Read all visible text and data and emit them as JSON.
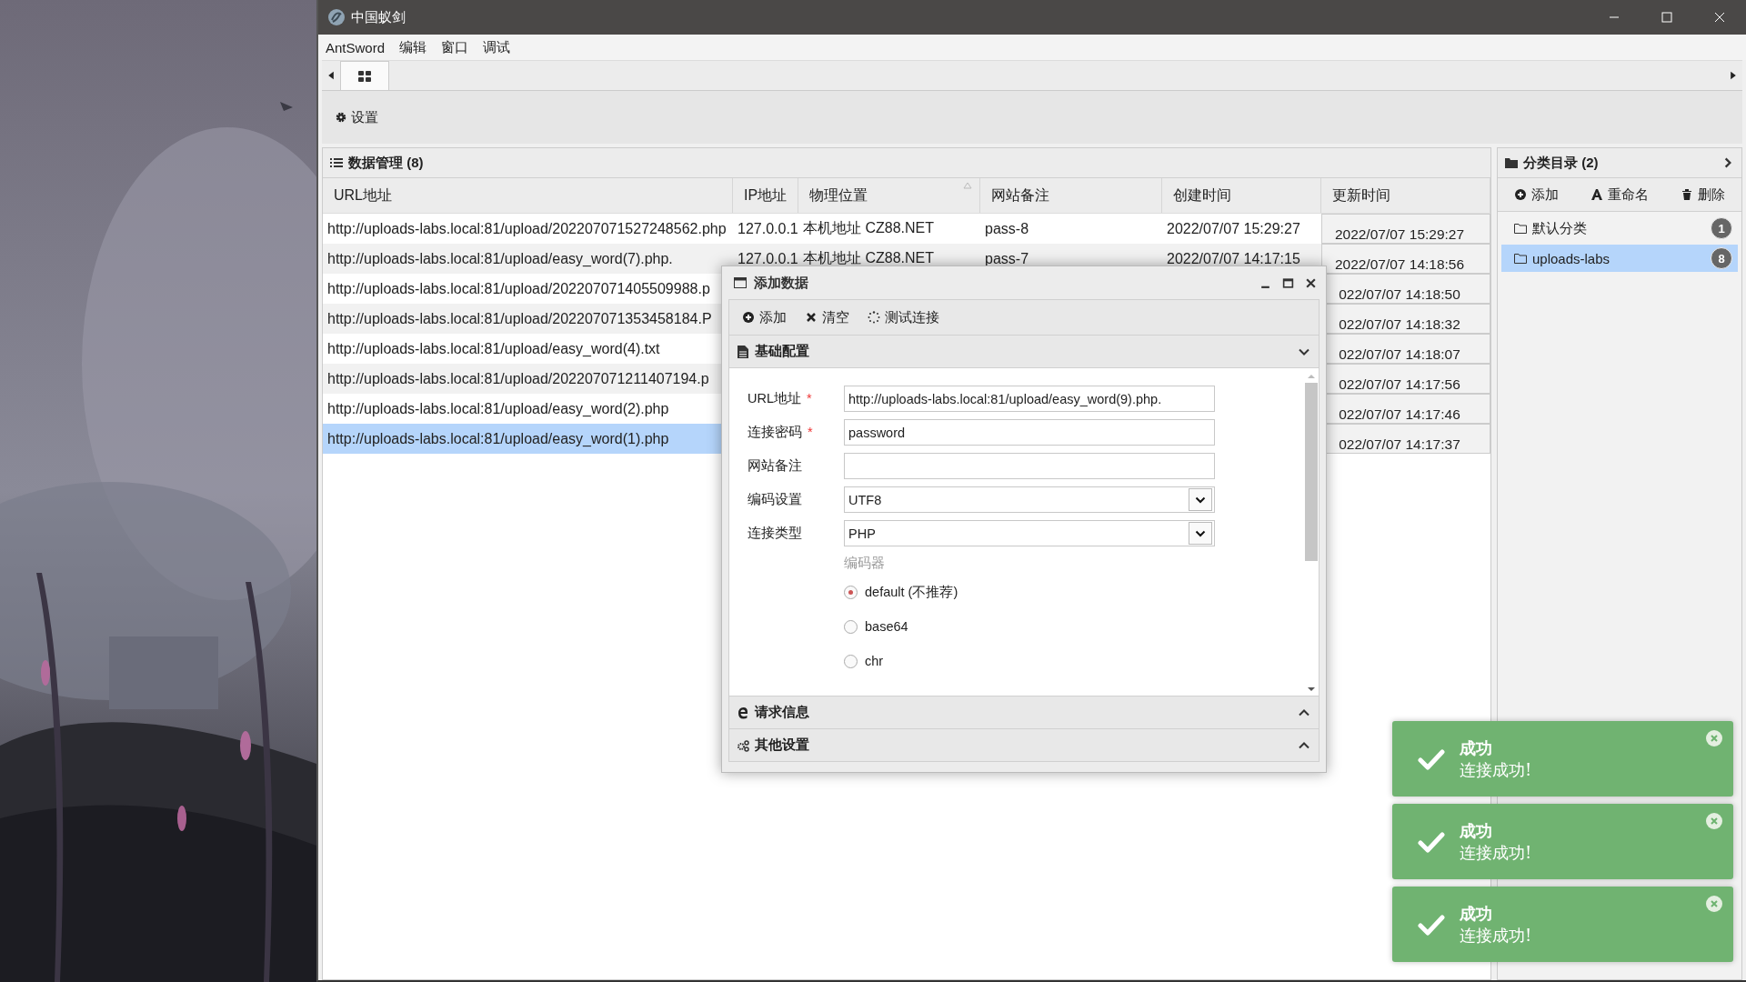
{
  "window": {
    "title": "中国蚁剑"
  },
  "menu": [
    "AntSword",
    "编辑",
    "窗口",
    "调试"
  ],
  "settings_button": "设置",
  "data_panel": {
    "title": "数据管理 (8)",
    "columns": [
      {
        "label": "URL地址",
        "sorted": false
      },
      {
        "label": "IP地址",
        "sorted": false
      },
      {
        "label": "物理位置",
        "sorted": true
      },
      {
        "label": "网站备注",
        "sorted": false
      },
      {
        "label": "创建时间",
        "sorted": false
      },
      {
        "label": "更新时间",
        "sorted": false
      }
    ],
    "rows": [
      {
        "url": "http://uploads-labs.local:81/upload/202207071527248562.php",
        "ip": "127.0.0.1",
        "location": "本机地址 CZ88.NET",
        "note": "pass-8",
        "created": "2022/07/07 15:29:27",
        "updated": "2022/07/07 15:29:27",
        "selected": false
      },
      {
        "url": "http://uploads-labs.local:81/upload/easy_word(7).php.",
        "ip": "127.0.0.1",
        "location": "本机地址 CZ88.NET",
        "note": "pass-7",
        "created": "2022/07/07 14:17:15",
        "updated": "2022/07/07 14:18:56",
        "selected": false
      },
      {
        "url": "http://uploads-labs.local:81/upload/202207071405509988.p",
        "updated": "022/07/07 14:18:50",
        "selected": false
      },
      {
        "url": "http://uploads-labs.local:81/upload/202207071353458184.P",
        "updated": "022/07/07 14:18:32",
        "selected": false
      },
      {
        "url": "http://uploads-labs.local:81/upload/easy_word(4).txt",
        "updated": "022/07/07 14:18:07",
        "selected": false
      },
      {
        "url": "http://uploads-labs.local:81/upload/202207071211407194.p",
        "updated": "022/07/07 14:17:56",
        "selected": false
      },
      {
        "url": "http://uploads-labs.local:81/upload/easy_word(2).php",
        "updated": "022/07/07 14:17:46",
        "selected": false
      },
      {
        "url": "http://uploads-labs.local:81/upload/easy_word(1).php",
        "updated": "022/07/07 14:17:37",
        "selected": true
      }
    ]
  },
  "category_panel": {
    "title": "分类目录 (2)",
    "actions": [
      {
        "kind": "add",
        "label": "添加"
      },
      {
        "kind": "rename",
        "label": "重命名"
      },
      {
        "kind": "delete",
        "label": "删除"
      }
    ],
    "items": [
      {
        "name": "默认分类",
        "count": "1",
        "selected": false
      },
      {
        "name": "uploads-labs",
        "count": "8",
        "selected": true
      }
    ]
  },
  "dialog": {
    "title": "添加数据",
    "actions": [
      {
        "kind": "add",
        "label": "添加"
      },
      {
        "kind": "clear",
        "label": "清空"
      },
      {
        "kind": "test",
        "label": "测试连接"
      }
    ],
    "sections": [
      {
        "kind": "basic",
        "title": "基础配置",
        "expanded": true
      },
      {
        "kind": "request",
        "title": "请求信息",
        "expanded": false
      },
      {
        "kind": "other",
        "title": "其他设置",
        "expanded": false
      }
    ],
    "required_mark": "*",
    "fields": [
      {
        "kind": "text",
        "label": "URL地址",
        "required": true,
        "value": "http://uploads-labs.local:81/upload/easy_word(9).php."
      },
      {
        "kind": "text",
        "label": "连接密码",
        "required": true,
        "value": "password"
      },
      {
        "kind": "text",
        "label": "网站备注",
        "required": false
      },
      {
        "kind": "select",
        "label": "编码设置",
        "required": false,
        "value": "UTF8"
      },
      {
        "kind": "select",
        "label": "连接类型",
        "required": false,
        "value": "PHP"
      }
    ],
    "encoder": {
      "label": "编码器",
      "options": [
        {
          "label": "default (不推荐)",
          "selected": true
        },
        {
          "label": "base64",
          "selected": false
        },
        {
          "label": "chr",
          "selected": false
        }
      ]
    }
  },
  "notifications": [
    {
      "title": "成功",
      "message": "连接成功!"
    },
    {
      "title": "成功",
      "message": "连接成功!"
    },
    {
      "title": "成功",
      "message": "连接成功!"
    }
  ]
}
